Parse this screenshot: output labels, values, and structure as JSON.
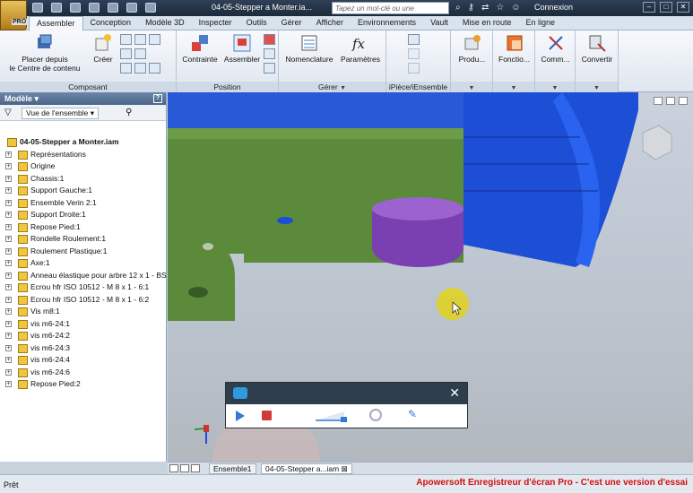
{
  "titlebar": {
    "app_button_label": "PRO",
    "title": "04-05-Stepper a Monter.ia...",
    "search_placeholder": "Tapez un mot-clé ou une expression",
    "sign_in": "Connexion"
  },
  "ribbon_tabs": [
    "Assembler",
    "Conception",
    "Modèle 3D",
    "Inspecter",
    "Outils",
    "Gérer",
    "Afficher",
    "Environnements",
    "Vault",
    "Mise en route",
    "En ligne"
  ],
  "active_tab": "Assembler",
  "ribbon": {
    "composant": {
      "label": "Composant",
      "placer_line1": "Placer depuis",
      "placer_line2": "le Centre de contenu",
      "creer": "Créer"
    },
    "position": {
      "label": "Position",
      "contrainte": "Contrainte",
      "assembler": "Assembler"
    },
    "gerer": {
      "label": "Gérer",
      "nomenclature": "Nomenclature",
      "parametres": "Paramètres"
    },
    "ipiece": {
      "label": "iPièce/iEnsemble"
    },
    "more": {
      "produ": "Produ...",
      "fonctio": "Fonctio...",
      "comm": "Comm...",
      "convertir": "Convertir"
    }
  },
  "panel": {
    "title": "Modèle",
    "view_selector": "Vue de l'ensemble",
    "tree": [
      {
        "label": "04-05-Stepper a Monter.iam",
        "root": true
      },
      {
        "label": "Représentations"
      },
      {
        "label": "Origine"
      },
      {
        "label": "Chassis:1"
      },
      {
        "label": "Support Gauche:1"
      },
      {
        "label": "Ensemble Verin 2:1"
      },
      {
        "label": "Support Droite:1"
      },
      {
        "label": "Repose Pied:1"
      },
      {
        "label": "Rondelle Roulement:1"
      },
      {
        "label": "Roulement Plastique:1"
      },
      {
        "label": "Axe:1"
      },
      {
        "label": "Anneau élastique pour arbre 12 x 1 - BS"
      },
      {
        "label": "Ecrou hfr  ISO 10512 - M 8 x 1 - 6:1"
      },
      {
        "label": "Ecrou hfr  ISO 10512 - M 8 x 1 - 6:2"
      },
      {
        "label": "Vis m8:1"
      },
      {
        "label": "vis m6-24:1"
      },
      {
        "label": "vis m6-24:2"
      },
      {
        "label": "vis m6-24:3"
      },
      {
        "label": "vis m6-24:4"
      },
      {
        "label": "vis m6-24:6"
      },
      {
        "label": "Repose Pied:2"
      }
    ]
  },
  "doc_tabs": [
    "Ensemble1",
    "04-05-Stepper a...iam"
  ],
  "status": "Prêt",
  "watermark": "Apowersoft Enregistreur d'écran Pro - C'est une version d'essai",
  "colors": {
    "green_part": "#5a8a3a",
    "blue_part": "#1d4fd6",
    "purple_part": "#7a3fb0",
    "cursor_highlight": "#e2d21c",
    "watermark": "#d30f0f"
  }
}
